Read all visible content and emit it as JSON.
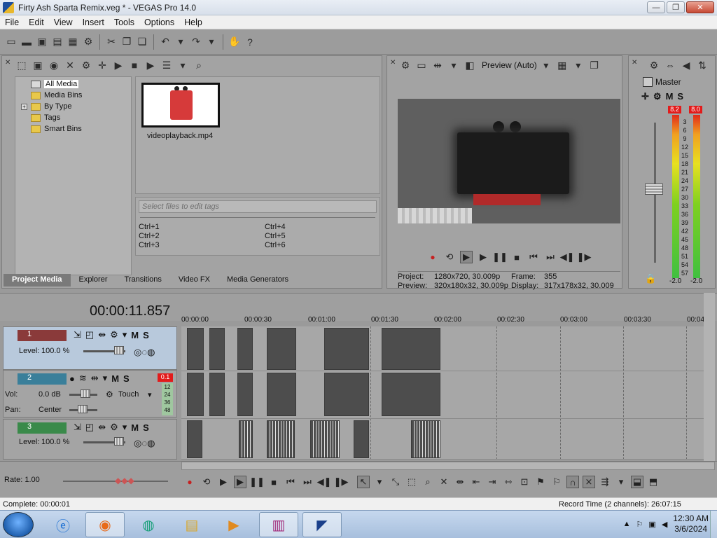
{
  "window": {
    "title": "Firty Ash Sparta Remix.veg * - VEGAS Pro 14.0",
    "minimize": "—",
    "maximize": "❐",
    "close": "✕"
  },
  "menu": [
    "File",
    "Edit",
    "View",
    "Insert",
    "Tools",
    "Options",
    "Help"
  ],
  "project_media": {
    "tree": [
      {
        "label": "All Media",
        "selected": true
      },
      {
        "label": "Media Bins"
      },
      {
        "label": "By Type",
        "expandable": true,
        "expander": "+"
      },
      {
        "label": "Tags"
      },
      {
        "label": "Smart Bins"
      }
    ],
    "file_name": "videoplayback.mp4",
    "tag_placeholder": "Select files to edit tags",
    "shortcuts": [
      "Ctrl+1",
      "Ctrl+4",
      "Ctrl+2",
      "Ctrl+5",
      "Ctrl+3",
      "Ctrl+6"
    ],
    "tabs": [
      "Project Media",
      "Explorer",
      "Transitions",
      "Video FX",
      "Media Generators"
    ]
  },
  "preview": {
    "mode": "Preview (Auto)",
    "project_label": "Project:",
    "project_value": "1280x720, 30.009p",
    "frame_label": "Frame:",
    "frame_value": "355",
    "preview_label": "Preview:",
    "preview_value": "320x180x32, 30.009p",
    "display_label": "Display:",
    "display_value": "317x178x32, 30.009"
  },
  "master": {
    "title": "Master",
    "mute": "M",
    "solo": "S",
    "peak_left": "8.2",
    "peak_right": "8.0",
    "scale": [
      "3",
      "6",
      "9",
      "12",
      "15",
      "18",
      "21",
      "24",
      "27",
      "30",
      "33",
      "36",
      "39",
      "42",
      "45",
      "48",
      "51",
      "54",
      "57"
    ],
    "bottom_left": "-2.0",
    "bottom_right": "-2.0"
  },
  "timeline": {
    "time": "00:00:11.857",
    "ruler": [
      "00:00:00",
      "00:00:30",
      "00:01:00",
      "00:01:30",
      "00:02:00",
      "00:02:30",
      "00:03:00",
      "00:03:30",
      "00:04:"
    ],
    "tracks": [
      {
        "num": "1",
        "type": "video",
        "level_label": "Level:",
        "level_value": "100.0 %",
        "mute": "M",
        "solo": "S"
      },
      {
        "num": "2",
        "type": "audio",
        "vol_label": "Vol:",
        "vol_value": "0.0 dB",
        "pan_label": "Pan:",
        "pan_value": "Center",
        "automation": "Touch",
        "peak": "0.1",
        "meter_marks": [
          "12",
          "24",
          "36",
          "48"
        ],
        "mute": "M",
        "solo": "S"
      },
      {
        "num": "3",
        "type": "video",
        "level_label": "Level:",
        "level_value": "100.0 %",
        "mute": "M",
        "solo": "S"
      }
    ]
  },
  "bottom": {
    "rate_label": "Rate:",
    "rate_value": "1.00"
  },
  "status": {
    "left": "Complete: 00:00:01",
    "right": "Record Time (2 channels): 26:07:15"
  },
  "taskbar": {
    "time": "12:30 AM",
    "date": "3/6/2024",
    "tray_arrow": "▲",
    "tray_flag": "⚐",
    "tray_network": "▣",
    "tray_volume": "◀"
  },
  "colors": {
    "panel_bg": "#a3a3a3",
    "selected_track": "#b8c9dc",
    "clip": "#4d4d4d",
    "record_red": "#c62020"
  }
}
